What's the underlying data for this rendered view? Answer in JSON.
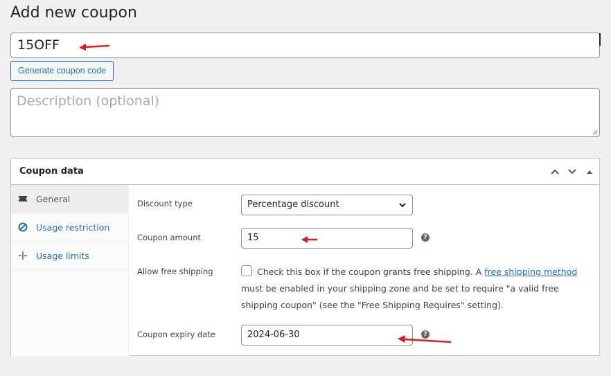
{
  "page": {
    "title": "Add new coupon"
  },
  "coupon": {
    "code_value": "15OFF",
    "generate_label": "Generate coupon code",
    "description_placeholder": "Description (optional)"
  },
  "panel": {
    "title": "Coupon data",
    "tabs": [
      {
        "label": "General",
        "icon": "ticket-icon",
        "active": true
      },
      {
        "label": "Usage restriction",
        "icon": "ban-icon",
        "active": false
      },
      {
        "label": "Usage limits",
        "icon": "limits-icon",
        "active": false
      }
    ],
    "general": {
      "discount_type_label": "Discount type",
      "discount_type_value": "Percentage discount",
      "amount_label": "Coupon amount",
      "amount_value": "15",
      "free_shipping_label": "Allow free shipping",
      "free_shipping_text_before": "Check this box if the coupon grants free shipping. A ",
      "free_shipping_link": "free shipping method",
      "free_shipping_text_after": " must be enabled in your shipping zone and be set to require \"a valid free shipping coupon\" (see the \"Free Shipping Requires\" setting).",
      "expiry_label": "Coupon expiry date",
      "expiry_value": "2024-06-30",
      "help_glyph": "?"
    }
  },
  "colors": {
    "accent": "#2271b1",
    "annotation": "#e0191f"
  }
}
